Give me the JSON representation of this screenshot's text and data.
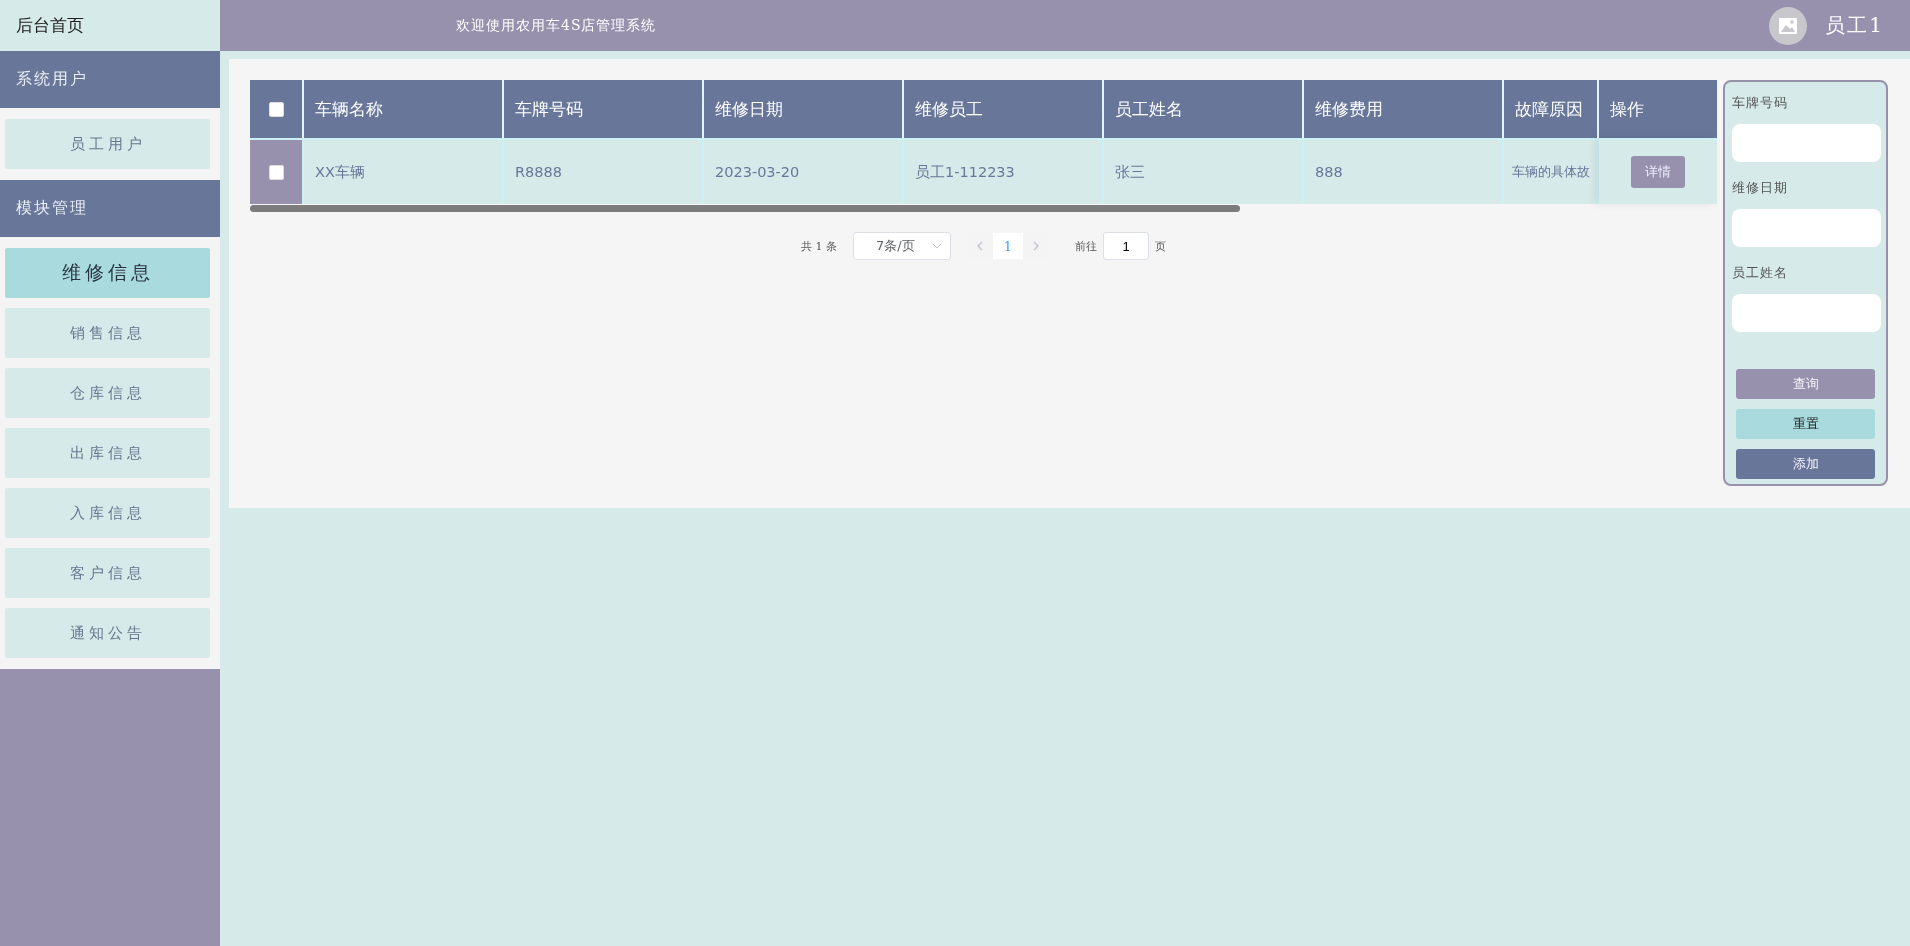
{
  "header": {
    "home": "后台首页",
    "title": "欢迎使用农用车4S店管理系统",
    "user": "员工1"
  },
  "sidebar": {
    "groups": [
      {
        "title": "系统用户",
        "items": [
          {
            "label": "员工用户",
            "selected": false
          }
        ]
      },
      {
        "title": "模块管理",
        "items": [
          {
            "label": "维修信息",
            "selected": true
          },
          {
            "label": "销售信息",
            "selected": false
          },
          {
            "label": "仓库信息",
            "selected": false
          },
          {
            "label": "出库信息",
            "selected": false
          },
          {
            "label": "入库信息",
            "selected": false
          },
          {
            "label": "客户信息",
            "selected": false
          },
          {
            "label": "通知公告",
            "selected": false
          }
        ]
      }
    ]
  },
  "table": {
    "select_all": {
      "checked": false
    },
    "columns": [
      "车辆名称",
      "车牌号码",
      "维修日期",
      "维修员工",
      "员工姓名",
      "维修费用",
      "故障原因",
      "操作"
    ],
    "rows": [
      {
        "checked": false,
        "cells": [
          "XX车辆",
          "R8888",
          "2023-03-20",
          "员工1-112233",
          "张三",
          "888",
          "车辆的具体故"
        ],
        "action": "详情"
      }
    ]
  },
  "pagination": {
    "total": "共 1 条",
    "page_size": "7条/页",
    "pages": [
      {
        "label": "1",
        "selected": true
      }
    ],
    "goto_label": "前往",
    "goto_value": "1",
    "goto_suffix": "页"
  },
  "search": {
    "fields": [
      {
        "label": "车牌号码"
      },
      {
        "label": "维修日期"
      },
      {
        "label": "员工姓名"
      }
    ],
    "buttons": [
      {
        "label": "查询",
        "kind": "search"
      },
      {
        "label": "重置",
        "kind": "reset"
      },
      {
        "label": "添加",
        "kind": "add"
      }
    ]
  }
}
